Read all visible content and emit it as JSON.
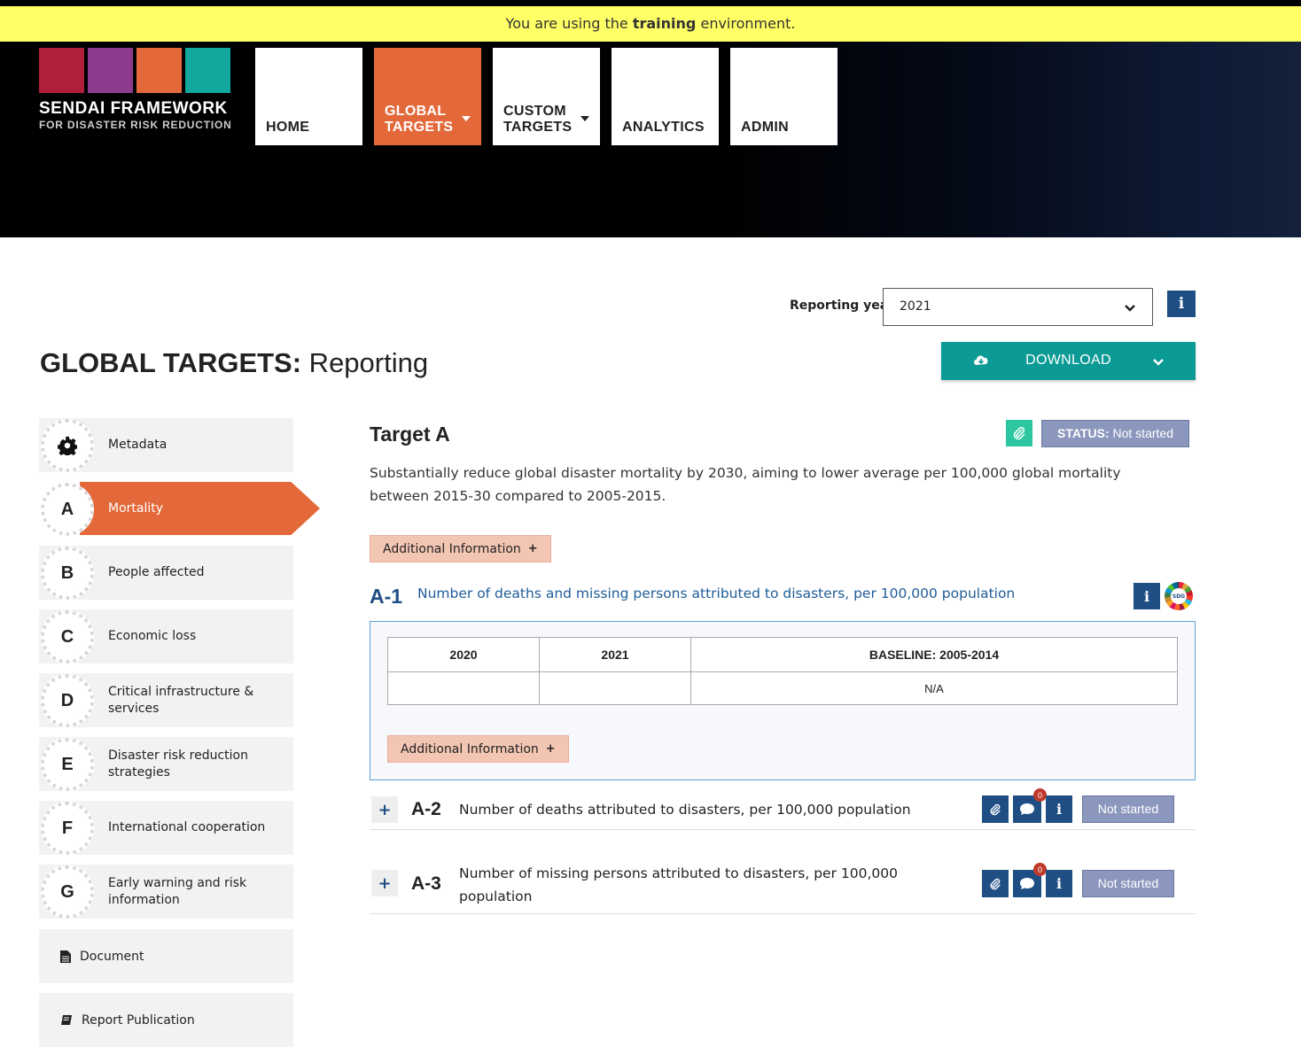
{
  "env_banner": {
    "prefix": "You are using the",
    "env": "training",
    "suffix": "environment."
  },
  "logo": {
    "title": "SENDAI FRAMEWORK",
    "subtitle": "FOR DISASTER RISK REDUCTION",
    "square_colors": [
      "#b0203a",
      "#8e3a8f",
      "#e3693a",
      "#12a89d"
    ]
  },
  "nav": [
    {
      "line1": "",
      "line2": "HOME",
      "dropdown": false,
      "active": false
    },
    {
      "line1": "GLOBAL",
      "line2": "TARGETS",
      "dropdown": true,
      "active": true
    },
    {
      "line1": "CUSTOM",
      "line2": "TARGETS",
      "dropdown": true,
      "active": false
    },
    {
      "line1": "",
      "line2": "ANALYTICS",
      "dropdown": false,
      "active": false
    },
    {
      "line1": "",
      "line2": "ADMIN",
      "dropdown": false,
      "active": false
    }
  ],
  "reporting_year": {
    "label": "Reporting year:",
    "value": "2021"
  },
  "page_title": {
    "bold": "GLOBAL TARGETS:",
    "rest": " Reporting"
  },
  "download": {
    "label": "DOWNLOAD"
  },
  "sidebar": {
    "items": [
      {
        "letter": "",
        "icon": "gear-icon",
        "label": "Metadata"
      },
      {
        "letter": "A",
        "label": "Mortality",
        "active": true
      },
      {
        "letter": "B",
        "label": "People affected"
      },
      {
        "letter": "C",
        "label": "Economic loss"
      },
      {
        "letter": "D",
        "label": "Critical infrastructure & services"
      },
      {
        "letter": "E",
        "label": "Disaster risk reduction strategies"
      },
      {
        "letter": "F",
        "label": "International cooperation"
      },
      {
        "letter": "G",
        "label": "Early warning and risk information"
      }
    ],
    "document": {
      "icon": "file-icon",
      "label": "Document"
    },
    "report": {
      "icon": "book-icon",
      "label": "Report Publication"
    }
  },
  "target": {
    "title": "Target A",
    "status_label": "STATUS:",
    "status_value": "Not started",
    "description": "Substantially reduce global disaster mortality by 2030, aiming to lower average per 100,000 global mortality between 2015-30 compared to 2005-2015.",
    "additional_info": "Additional Information",
    "plus": "+"
  },
  "indicator_a1": {
    "code": "A-1",
    "title": "Number of deaths and missing persons attributed to disasters, per 100,000 population",
    "sdg_label": "SDG",
    "table": {
      "headers": [
        "2020",
        "2021",
        "BASELINE: 2005-2014"
      ],
      "row": [
        "",
        "",
        "N/A"
      ]
    },
    "additional_info": "Additional Information",
    "plus": "+"
  },
  "indicators": [
    {
      "code": "A-2",
      "title": "Number of deaths attributed to disasters, per 100,000 population",
      "comments": "0",
      "status": "Not started",
      "expand": "+"
    },
    {
      "code": "A-3",
      "title": "Number of missing persons attributed to disasters, per 100,000 population",
      "comments": "0",
      "status": "Not started",
      "expand": "+"
    }
  ]
}
